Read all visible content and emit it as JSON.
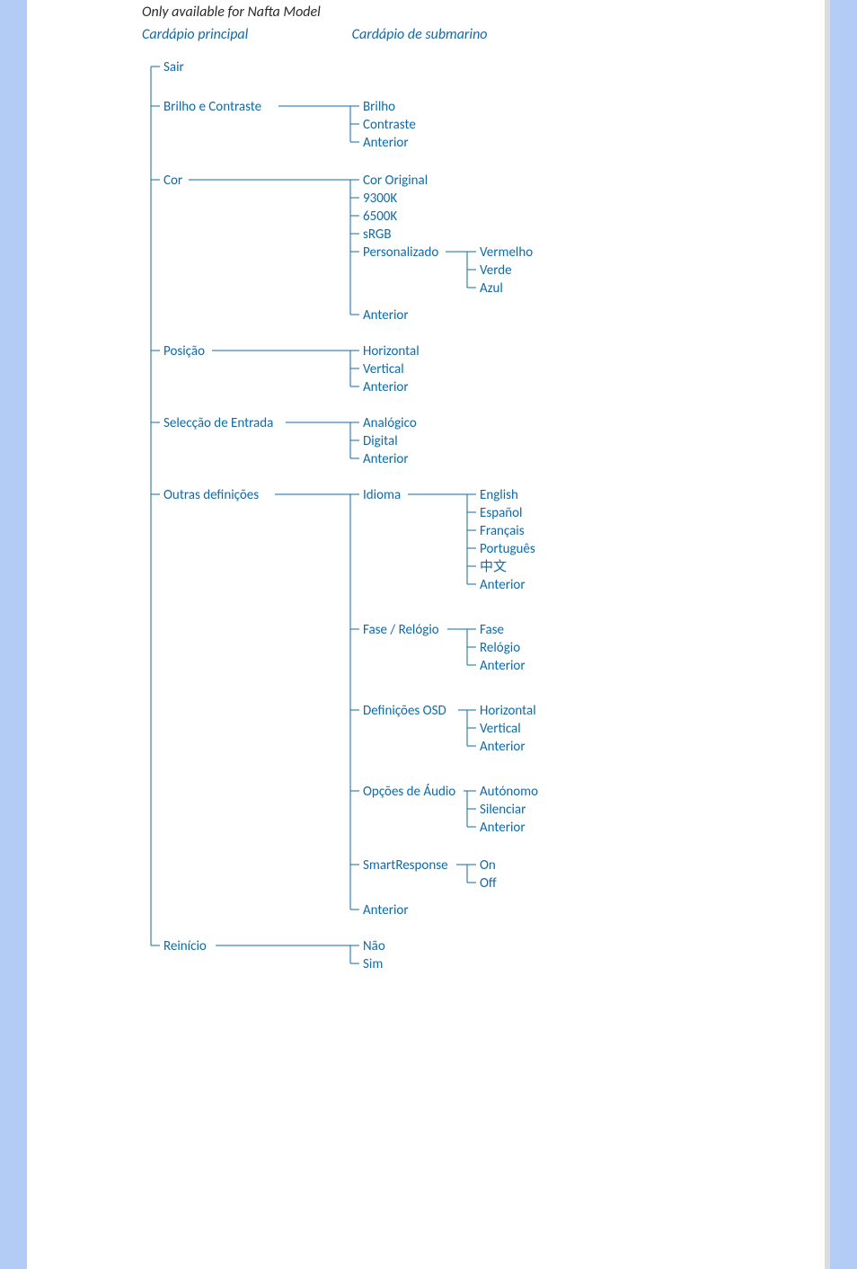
{
  "note": "Only available for Nafta Model",
  "header_main": "Cardápio principal",
  "header_sub": "Cardápio de submarino",
  "menu": {
    "sair": "Sair",
    "brilho_contraste": {
      "label": "Brilho e Contraste",
      "items": {
        "brilho": "Brilho",
        "contraste": "Contraste",
        "anterior": "Anterior"
      }
    },
    "cor": {
      "label": "Cor",
      "items": {
        "original": "Cor Original",
        "k9300": "9300K",
        "k6500": "6500K",
        "srgb": "sRGB",
        "personalizado": {
          "label": "Personalizado",
          "items": {
            "vermelho": "Vermelho",
            "verde": "Verde",
            "azul": "Azul"
          }
        },
        "anterior": "Anterior"
      }
    },
    "posicao": {
      "label": "Posição",
      "items": {
        "horizontal": "Horizontal",
        "vertical": "Vertical",
        "anterior": "Anterior"
      }
    },
    "entrada": {
      "label": "Selecção de Entrada",
      "items": {
        "analogico": "Analógico",
        "digital": "Digital",
        "anterior": "Anterior"
      }
    },
    "outras": {
      "label": "Outras definições",
      "items": {
        "idioma": {
          "label": "Idioma",
          "items": {
            "en": "English",
            "es": "Español",
            "fr": "Français",
            "pt": "Português",
            "zh": "中文",
            "anterior": "Anterior"
          }
        },
        "fase": {
          "label": "Fase / Relógio",
          "items": {
            "fase": "Fase",
            "relogio": "Relógio",
            "anterior": "Anterior"
          }
        },
        "osd": {
          "label": "Definições OSD",
          "items": {
            "horizontal": "Horizontal",
            "vertical": "Vertical",
            "anterior": "Anterior"
          }
        },
        "audio": {
          "label": "Opções de Áudio",
          "items": {
            "autonomo": "Autónomo",
            "silenciar": "Silenciar",
            "anterior": "Anterior"
          }
        },
        "smart": {
          "label": "SmartResponse",
          "items": {
            "on": "On",
            "off": "Off"
          }
        },
        "anterior": "Anterior"
      }
    },
    "reinicio": {
      "label": "Reinício",
      "items": {
        "nao": "Não",
        "sim": "Sim"
      }
    }
  }
}
